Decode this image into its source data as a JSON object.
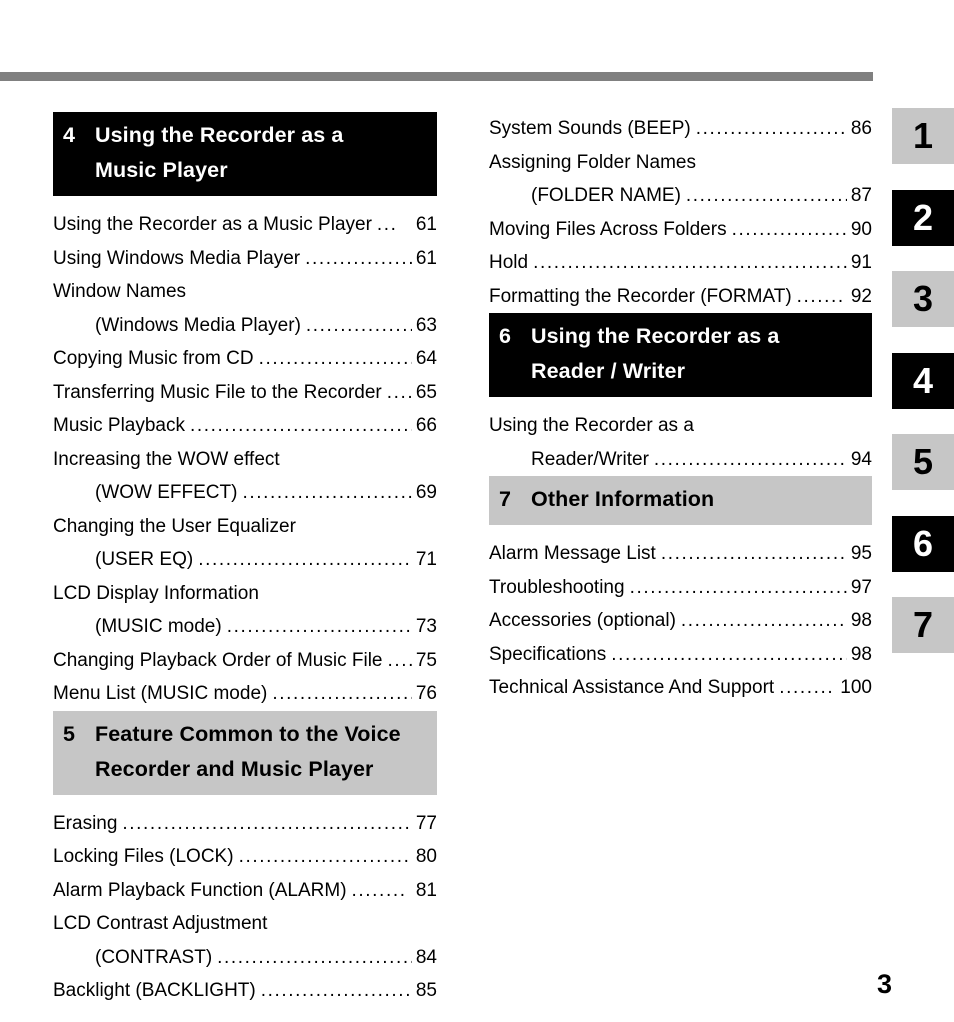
{
  "page": {
    "number": "3",
    "rule_color": "#808080",
    "dark_color": "#000000",
    "light_color": "#c6c6c6"
  },
  "columns": {
    "left": [
      {
        "kind": "chapter",
        "style": "dark",
        "number": "4",
        "lines": [
          "Using the Recorder as a",
          "Music Player"
        ]
      },
      {
        "kind": "entries",
        "items": [
          {
            "title": "Using the Recorder as a Music Player",
            "leader": "...",
            "page": "61",
            "indent": false
          },
          {
            "title": "Using Windows Media Player",
            "leader": ".................",
            "page": "61",
            "indent": false
          },
          {
            "title": "Window Names",
            "leader": "",
            "page": "",
            "indent": false,
            "nopage": true
          },
          {
            "title": "(Windows Media Player)",
            "leader": "...................",
            "page": "63",
            "indent": true
          },
          {
            "title": "Copying Music from CD",
            "leader": "..........................",
            "page": "64",
            "indent": false
          },
          {
            "title": "Transferring Music File to the Recorder",
            "leader": "....",
            "page": "65",
            "indent": false
          },
          {
            "title": "Music Playback",
            "leader": "........................................",
            "page": "66",
            "indent": false
          },
          {
            "title": "Increasing the WOW effect",
            "leader": "",
            "page": "",
            "indent": false,
            "nopage": true
          },
          {
            "title": "(WOW EFFECT)",
            "leader": "................................",
            "page": "69",
            "indent": true
          },
          {
            "title": "Changing the User Equalizer",
            "leader": "",
            "page": "",
            "indent": false,
            "nopage": true
          },
          {
            "title": "(USER EQ)",
            "leader": "........................................",
            "page": "71",
            "indent": true
          },
          {
            "title": "LCD Display Information",
            "leader": "",
            "page": "",
            "indent": false,
            "nopage": true
          },
          {
            "title": "(MUSIC mode)",
            "leader": "..................................",
            "page": "73",
            "indent": true
          },
          {
            "title": "Changing Playback Order of Music File",
            "leader": "....",
            "page": "75",
            "indent": false
          },
          {
            "title": "Menu List (MUSIC mode)",
            "leader": "........................",
            "page": "76",
            "indent": false
          }
        ]
      },
      {
        "kind": "chapter",
        "style": "light",
        "number": "5",
        "lines": [
          "Feature Common to the Voice",
          "Recorder and Music Player"
        ]
      },
      {
        "kind": "entries",
        "items": [
          {
            "title": "Erasing",
            "leader": ".....................................................",
            "page": "77",
            "indent": false
          },
          {
            "title": "Locking Files (LOCK)",
            "leader": "..............................",
            "page": "80",
            "indent": false
          },
          {
            "title": "Alarm Playback Function (ALARM)",
            "leader": "........",
            "page": "81",
            "indent": false
          },
          {
            "title": "LCD Contrast Adjustment",
            "leader": "",
            "page": "",
            "indent": false,
            "nopage": true
          },
          {
            "title": "(CONTRAST)",
            "leader": ".....................................",
            "page": "84",
            "indent": true
          },
          {
            "title": "Backlight (BACKLIGHT)",
            "leader": "...........................",
            "page": "85",
            "indent": false
          }
        ]
      }
    ],
    "right": [
      {
        "kind": "entries",
        "first": true,
        "items": [
          {
            "title": "System Sounds (BEEP)",
            "leader": ".........................",
            "page": "86",
            "indent": false
          },
          {
            "title": "Assigning Folder Names",
            "leader": "",
            "page": "",
            "indent": false,
            "nopage": true
          },
          {
            "title": "(FOLDER NAME)",
            "leader": "..............................",
            "page": "87",
            "indent": true
          },
          {
            "title": "Moving Files Across Folders",
            "leader": "...................",
            "page": "90",
            "indent": false
          },
          {
            "title": "Hold",
            "leader": "..........................................................",
            "page": "91",
            "indent": false
          },
          {
            "title": "Formatting the Recorder (FORMAT)",
            "leader": ".......",
            "page": "92",
            "indent": false
          }
        ]
      },
      {
        "kind": "chapter",
        "style": "dark",
        "number": "6",
        "lines": [
          "Using the Recorder as a",
          "Reader / Writer"
        ]
      },
      {
        "kind": "entries",
        "items": [
          {
            "title": "Using the Recorder as a",
            "leader": "",
            "page": "",
            "indent": false,
            "nopage": true
          },
          {
            "title": "Reader/Writer",
            "leader": "....................................",
            "page": "94",
            "indent": true
          }
        ]
      },
      {
        "kind": "chapter",
        "style": "light",
        "number": "7",
        "lines": [
          "Other Information"
        ]
      },
      {
        "kind": "entries",
        "items": [
          {
            "title": "Alarm Message List",
            "leader": "..................................",
            "page": "95",
            "indent": false
          },
          {
            "title": "Troubleshooting",
            "leader": "........................................",
            "page": "97",
            "indent": false
          },
          {
            "title": "Accessories (optional)",
            "leader": ".............................",
            "page": "98",
            "indent": false
          },
          {
            "title": "Specifications",
            "leader": "...........................................",
            "page": "98",
            "indent": false
          },
          {
            "title": "Technical Assistance And Support",
            "leader": "........",
            "page": "100",
            "indent": false
          }
        ]
      }
    ]
  },
  "side_tabs": [
    {
      "label": "1",
      "style": "light"
    },
    {
      "label": "2",
      "style": "dark"
    },
    {
      "label": "3",
      "style": "light"
    },
    {
      "label": "4",
      "style": "dark"
    },
    {
      "label": "5",
      "style": "light"
    },
    {
      "label": "6",
      "style": "dark"
    },
    {
      "label": "7",
      "style": "light"
    }
  ]
}
